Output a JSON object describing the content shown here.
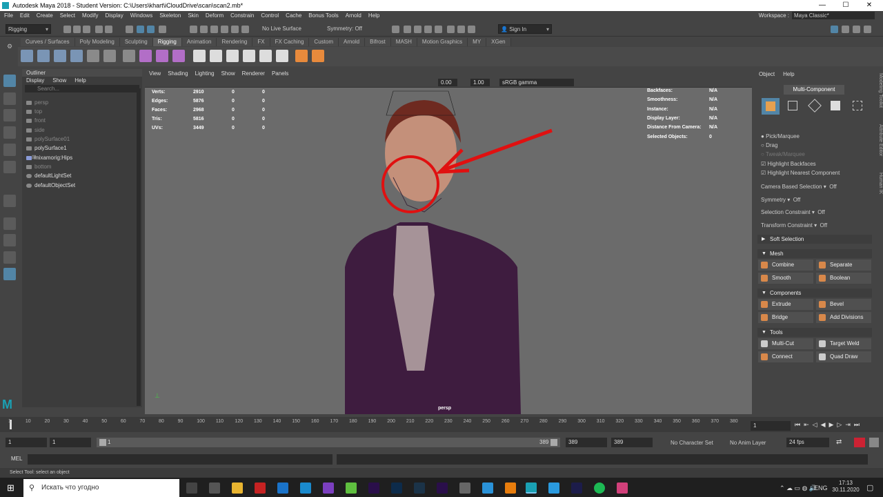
{
  "window": {
    "title": "Autodesk Maya 2018 - Student Version: C:\\Users\\khart\\iCloudDrive\\scan\\scan2.mb*"
  },
  "menubar": {
    "items": [
      "File",
      "Edit",
      "Create",
      "Select",
      "Modify",
      "Display",
      "Windows",
      "Skeleton",
      "Skin",
      "Deform",
      "Constrain",
      "Control",
      "Cache",
      "Bonus Tools",
      "Arnold",
      "Help"
    ]
  },
  "workspace": {
    "label": "Workspace :",
    "value": "Maya Classic*"
  },
  "statusline": {
    "menuset": "Rigging",
    "live_surface": "No Live Surface",
    "symmetry": "Symmetry: Off",
    "sign_in": "Sign In"
  },
  "shelf": {
    "tabs": [
      "Curves / Surfaces",
      "Poly Modeling",
      "Sculpting",
      "Rigging",
      "Animation",
      "Rendering",
      "FX",
      "FX Caching",
      "Custom",
      "Arnold",
      "Bifrost",
      "MASH",
      "Motion Graphics",
      "MY",
      "XGen"
    ],
    "active": "Rigging"
  },
  "outliner": {
    "title": "Outliner",
    "menu": [
      "Display",
      "Show",
      "Help"
    ],
    "search_placeholder": "Search...",
    "items": [
      "persp",
      "top",
      "front",
      "side",
      "polySurface01",
      "polySurface1",
      "mixamorig:Hips",
      "bottom",
      "defaultLightSet",
      "defaultObjectSet"
    ]
  },
  "viewport": {
    "menu": [
      "View",
      "Shading",
      "Lighting",
      "Show",
      "Renderer",
      "Panels"
    ],
    "exposure": "0.00",
    "gamma": "1.00",
    "colorspace": "sRGB gamma",
    "camera_label": "persp",
    "hud_left": [
      {
        "label": "Verts:",
        "a": "2910",
        "b": "0",
        "c": "0"
      },
      {
        "label": "Edges:",
        "a": "5876",
        "b": "0",
        "c": "0"
      },
      {
        "label": "Faces:",
        "a": "2968",
        "b": "0",
        "c": "0"
      },
      {
        "label": "Tris:",
        "a": "5816",
        "b": "0",
        "c": "0"
      },
      {
        "label": "UVs:",
        "a": "3449",
        "b": "0",
        "c": "0"
      }
    ],
    "hud_right": [
      {
        "label": "Backfaces:",
        "value": "N/A"
      },
      {
        "label": "Smoothness:",
        "value": "N/A"
      },
      {
        "label": "Instance:",
        "value": "N/A"
      },
      {
        "label": "Display Layer:",
        "value": "N/A"
      },
      {
        "label": "Distance From Camera:",
        "value": "N/A"
      },
      {
        "label": "Selected Objects:",
        "value": "0"
      }
    ]
  },
  "modeling_toolkit": {
    "menu": [
      "Object",
      "Help"
    ],
    "mode_label": "Multi-Component",
    "options": [
      "Pick/Marquee",
      "Drag",
      "Tweak/Marquee",
      "Highlight Backfaces",
      "Highlight Nearest Component"
    ],
    "camera_based": {
      "label": "Camera Based Selection",
      "value": "Off"
    },
    "symmetry": {
      "label": "Symmetry",
      "value": "Off"
    },
    "selection_constraint": {
      "label": "Selection Constraint",
      "value": "Off"
    },
    "transform_constraint": {
      "label": "Transform Constraint",
      "value": "Off"
    },
    "soft_selection": "Soft Selection",
    "mesh": {
      "title": "Mesh",
      "buttons": [
        "Combine",
        "Separate",
        "Smooth",
        "Boolean"
      ]
    },
    "components": {
      "title": "Components",
      "buttons": [
        "Extrude",
        "Bevel",
        "Bridge",
        "Add Divisions"
      ]
    },
    "tools": {
      "title": "Tools",
      "buttons": [
        "Multi-Cut",
        "Target Weld",
        "Connect",
        "Quad Draw"
      ]
    },
    "side_tabs": [
      "Modeling Toolkit",
      "Attribute Editor",
      "Human IK"
    ]
  },
  "timeline": {
    "ticks": [
      "1",
      "10",
      "20",
      "30",
      "40",
      "50",
      "60",
      "70",
      "80",
      "90",
      "100",
      "110",
      "120",
      "130",
      "140",
      "150",
      "160",
      "170",
      "180",
      "190",
      "200",
      "210",
      "220",
      "230",
      "240",
      "250",
      "260",
      "270",
      "280",
      "290",
      "300",
      "310",
      "320",
      "330",
      "340",
      "350",
      "360",
      "370",
      "380"
    ],
    "current_frame": "1"
  },
  "range": {
    "start": "1",
    "start_inner": "1",
    "slider_start": "1",
    "slider_end": "389",
    "end_inner": "389",
    "end": "389",
    "character_set": "No Character Set",
    "anim_layer": "No Anim Layer",
    "fps": "24 fps"
  },
  "cmdline": {
    "label": "MEL"
  },
  "helpline": {
    "text": "Select Tool: select an object"
  },
  "taskbar": {
    "search_placeholder": "Искать что угодно",
    "lang": "ENG",
    "time": "17:13",
    "date": "30.11.2020"
  },
  "colors": {
    "annotation": "#e01010",
    "accent": "#5285a6"
  }
}
